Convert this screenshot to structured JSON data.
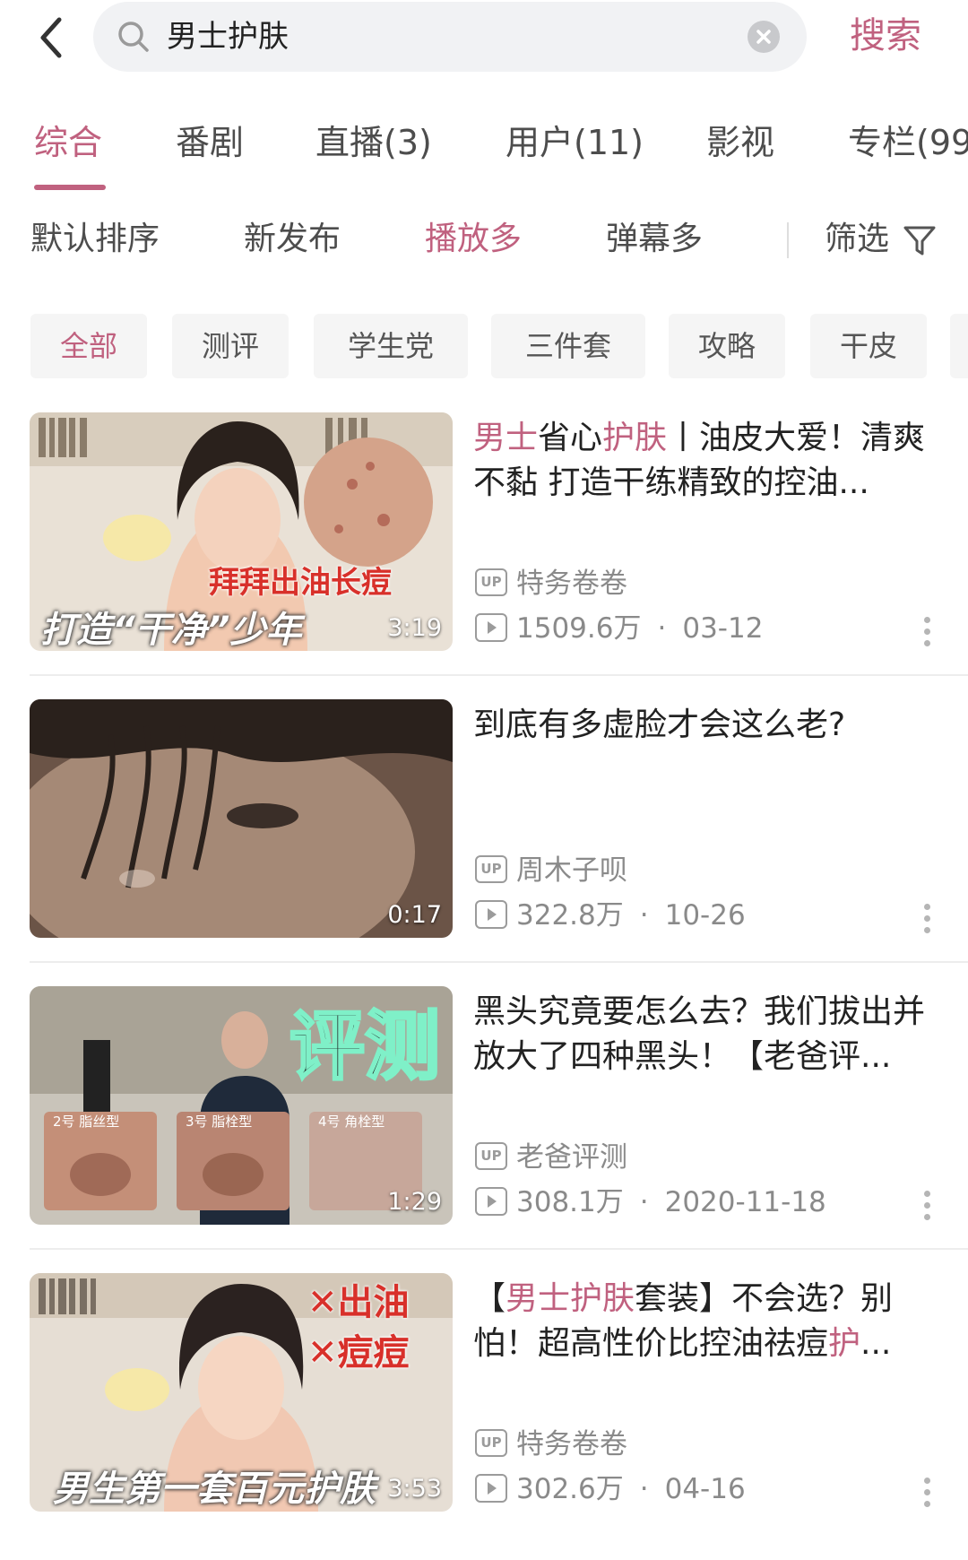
{
  "search": {
    "query": "男士护肤",
    "button_label": "搜索"
  },
  "tabs": [
    {
      "label": "综合",
      "active": true
    },
    {
      "label": "番剧",
      "active": false
    },
    {
      "label": "直播(3)",
      "active": false
    },
    {
      "label": "用户(11)",
      "active": false
    },
    {
      "label": "影视",
      "active": false
    },
    {
      "label": "专栏(99",
      "active": false
    }
  ],
  "sort": {
    "options": [
      {
        "label": "默认排序",
        "active": false
      },
      {
        "label": "新发布",
        "active": false
      },
      {
        "label": "播放多",
        "active": true
      },
      {
        "label": "弹幕多",
        "active": false
      }
    ],
    "filter_label": "筛选"
  },
  "chips": [
    {
      "label": "全部",
      "active": true
    },
    {
      "label": "测评",
      "active": false
    },
    {
      "label": "学生党",
      "active": false
    },
    {
      "label": "三件套",
      "active": false
    },
    {
      "label": "攻略",
      "active": false
    },
    {
      "label": "干皮",
      "active": false
    }
  ],
  "videos": [
    {
      "title_parts": [
        {
          "text": "男士",
          "hl": true
        },
        {
          "text": "省心",
          "hl": false
        },
        {
          "text": "护肤",
          "hl": true
        },
        {
          "text": "丨油皮大爱！清爽不黏 打造干练精致的控油...",
          "hl": false
        }
      ],
      "uploader": "特务卷卷",
      "views": "1509.6万",
      "date": "03-12",
      "duration": "3:19",
      "thumb_palette": [
        "#e9e1d6",
        "#3a2f2b",
        "#f2c9b0"
      ],
      "thumb_texts": [
        "拜拜出油长痘",
        "打造“干净”少年"
      ]
    },
    {
      "title_parts": [
        {
          "text": "到底有多虚脸才会这么老?",
          "hl": false
        }
      ],
      "uploader": "周木子呗",
      "views": "322.8万",
      "date": "10-26",
      "duration": "0:17",
      "thumb_palette": [
        "#6b5447",
        "#2a211c",
        "#a58976"
      ],
      "thumb_texts": []
    },
    {
      "title_parts": [
        {
          "text": "黑头究竟要怎么去？我们拔出并放大了四种黑头！【老爸评...",
          "hl": false
        }
      ],
      "uploader": "老爸评测",
      "views": "308.1万",
      "date": "2020-11-18",
      "duration": "1:29",
      "thumb_palette": [
        "#c9c4ba",
        "#1f2a3a",
        "#c48f78"
      ],
      "thumb_texts": [
        "评测",
        "2号 脂丝型",
        "3号 脂栓型",
        "4号 角栓型"
      ]
    },
    {
      "title_parts": [
        {
          "text": "【",
          "hl": false
        },
        {
          "text": "男士护肤",
          "hl": true
        },
        {
          "text": "套装】不会选？别怕！超高性价比控油祛痘",
          "hl": false
        },
        {
          "text": "护",
          "hl": true
        },
        {
          "text": "...",
          "hl": false
        }
      ],
      "uploader": "特务卷卷",
      "views": "302.6万",
      "date": "04-16",
      "duration": "3:53",
      "thumb_palette": [
        "#e6ded4",
        "#2b2220",
        "#f1c8b2"
      ],
      "thumb_texts": [
        "✕出油",
        "✕痘痘",
        "男生第一套百元护肤"
      ]
    }
  ],
  "colors": {
    "accent": "#c0617f",
    "text": "#222222",
    "meta": "#8a8a8a",
    "chip_bg": "#f5f5f5"
  }
}
